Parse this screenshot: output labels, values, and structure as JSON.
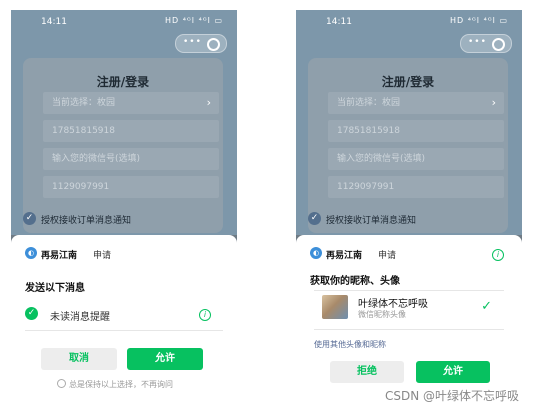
{
  "status_bar": {
    "time": "14:11",
    "signal": "HD ⁴ᴳl ⁴ᴳl ▭"
  },
  "capsule": {
    "menu_glyph": "•••"
  },
  "login_card": {
    "title": "注册/登录",
    "fields": [
      "当前选择：枚园",
      "17851815918",
      "输入您的微信号(选填)",
      "1129097991"
    ]
  },
  "auth_notice": "授权接收订单消息通知",
  "left_sheet": {
    "app_name": "再易江南",
    "app_action": "申请",
    "title": "发送以下消息",
    "permission": "未读消息提醒",
    "cancel": "取消",
    "allow": "允许",
    "remember": "总是保持以上选择，不再询问"
  },
  "right_sheet": {
    "app_name": "再易江南",
    "app_action": "申请",
    "title": "获取你的昵称、头像",
    "profile_name": "叶绿体不忘呼吸",
    "profile_sub": "微信昵称头像",
    "other_link": "使用其他头像和昵称",
    "reject": "拒绝",
    "allow": "允许"
  },
  "watermark": "CSDN @叶绿体不忘呼吸",
  "colors": {
    "wechat_green": "#07c160",
    "dim_overlay": "#6f7b85"
  }
}
